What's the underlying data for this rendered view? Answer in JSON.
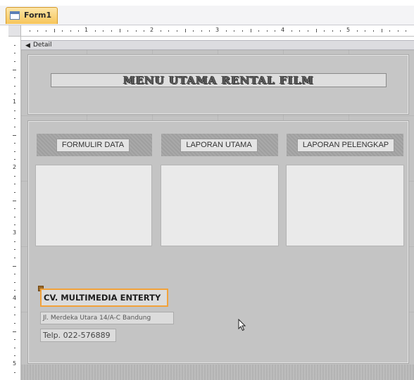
{
  "tab": {
    "label": "Form1",
    "icon": "form-icon"
  },
  "section": {
    "label": "Detail",
    "icon": "section-arrow-icon"
  },
  "ruler": {
    "h_numbers": [
      "1",
      "2",
      "3",
      "4",
      "5"
    ],
    "v_numbers": [
      "1",
      "2",
      "3",
      "4",
      "5"
    ]
  },
  "title": "MENU UTAMA RENTAL FILM",
  "columns": [
    {
      "label": "FORMULIR DATA"
    },
    {
      "label": "LAPORAN UTAMA"
    },
    {
      "label": "LAPORAN PELENGKAP"
    }
  ],
  "company": {
    "name": "CV. MULTIMEDIA ENTERTY",
    "address": "Jl. Merdeka Utara 14/A-C Bandung",
    "phone": "Telp. 022-576889"
  },
  "colors": {
    "selection": "#f2a23a",
    "canvas": "#c3c3c3",
    "tab": "#f7c55a"
  }
}
